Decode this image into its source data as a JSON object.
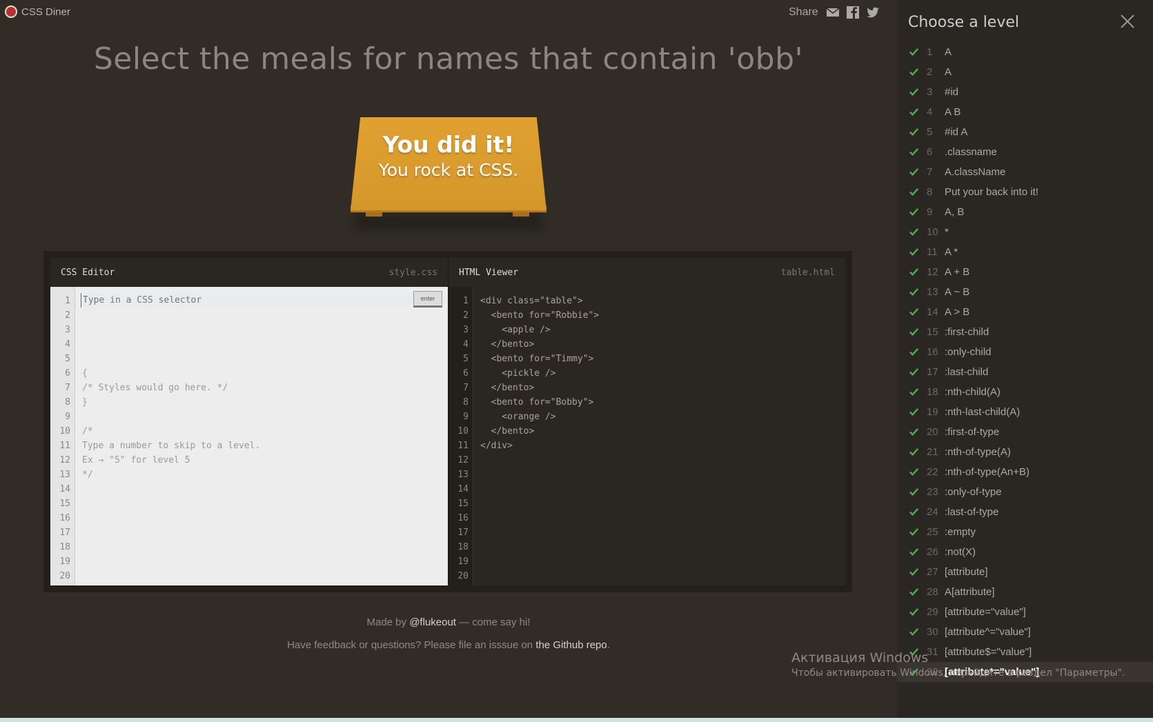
{
  "app": {
    "title": "CSS Diner"
  },
  "share": {
    "label": "Share",
    "icons": [
      "mail-icon",
      "facebook-icon",
      "twitter-icon"
    ]
  },
  "instructions": "Select the meals for names that contain 'obb'",
  "success": {
    "line1": "You did it!",
    "line2": "You rock at CSS."
  },
  "css_editor": {
    "title": "CSS Editor",
    "file": "style.css",
    "placeholder": "Type in a CSS selector",
    "enter_label": "enter",
    "line_numbers": [
      "1",
      "2",
      "3",
      "4",
      "5",
      "6",
      "7",
      "8",
      "9",
      "10",
      "11",
      "12",
      "13",
      "14",
      "15",
      "16",
      "17",
      "18",
      "19",
      "20"
    ],
    "lines": [
      "",
      "{",
      "/* Styles would go here. */",
      "}",
      "",
      "/*",
      "Type a number to skip to a level.",
      "Ex → \"5\" for level 5",
      "*/"
    ]
  },
  "html_viewer": {
    "title": "HTML Viewer",
    "file": "table.html",
    "line_numbers": [
      "1",
      "2",
      "3",
      "4",
      "5",
      "6",
      "7",
      "8",
      "9",
      "10",
      "11",
      "12",
      "13",
      "14",
      "15",
      "16",
      "17",
      "18",
      "19",
      "20"
    ],
    "lines": [
      "<div class=\"table\">",
      "  <bento for=\"Robbie\">",
      "    <apple />",
      "  </bento>",
      "  <bento for=\"Timmy\">",
      "    <pickle />",
      "  </bento>",
      "  <bento for=\"Bobby\">",
      "    <orange />",
      "  </bento>",
      "</div>"
    ]
  },
  "footer": {
    "line1_prefix": "Made by ",
    "line1_link": "@flukeout",
    "line1_suffix": " — come say hi!",
    "line2_prefix": "Have feedback or questions? Please file an isssue on ",
    "line2_link": "the Github repo",
    "line2_suffix": "."
  },
  "levels": {
    "title": "Choose a level",
    "items": [
      {
        "num": "1",
        "label": "A"
      },
      {
        "num": "2",
        "label": "A"
      },
      {
        "num": "3",
        "label": "#id"
      },
      {
        "num": "4",
        "label": "A  B"
      },
      {
        "num": "5",
        "label": "#id  A"
      },
      {
        "num": "6",
        "label": ".classname"
      },
      {
        "num": "7",
        "label": "A.className"
      },
      {
        "num": "8",
        "label": "Put your back into it!"
      },
      {
        "num": "9",
        "label": "A, B"
      },
      {
        "num": "10",
        "label": "*"
      },
      {
        "num": "11",
        "label": "A *"
      },
      {
        "num": "12",
        "label": "A + B"
      },
      {
        "num": "13",
        "label": "A ~ B"
      },
      {
        "num": "14",
        "label": "A > B"
      },
      {
        "num": "15",
        "label": ":first-child"
      },
      {
        "num": "16",
        "label": ":only-child"
      },
      {
        "num": "17",
        "label": ":last-child"
      },
      {
        "num": "18",
        "label": ":nth-child(A)"
      },
      {
        "num": "19",
        "label": ":nth-last-child(A)"
      },
      {
        "num": "20",
        "label": ":first-of-type"
      },
      {
        "num": "21",
        "label": ":nth-of-type(A)"
      },
      {
        "num": "22",
        "label": ":nth-of-type(An+B)"
      },
      {
        "num": "23",
        "label": ":only-of-type"
      },
      {
        "num": "24",
        "label": ":last-of-type"
      },
      {
        "num": "25",
        "label": ":empty"
      },
      {
        "num": "26",
        "label": ":not(X)"
      },
      {
        "num": "27",
        "label": "[attribute]"
      },
      {
        "num": "28",
        "label": "A[attribute]"
      },
      {
        "num": "29",
        "label": "[attribute=\"value\"]"
      },
      {
        "num": "30",
        "label": "[attribute^=\"value\"]"
      },
      {
        "num": "31",
        "label": "[attribute$=\"value\"]"
      },
      {
        "num": "32",
        "label": "[attribute*=\"value\"]"
      }
    ],
    "current": "32"
  },
  "os_watermark": {
    "title": "Активация Windows",
    "subtitle": "Чтобы активировать Windows, перейдите в раздел \"Параметры\"."
  },
  "colors": {
    "accent": "#e1a131",
    "check": "#4caf50",
    "background": "#312c26"
  }
}
